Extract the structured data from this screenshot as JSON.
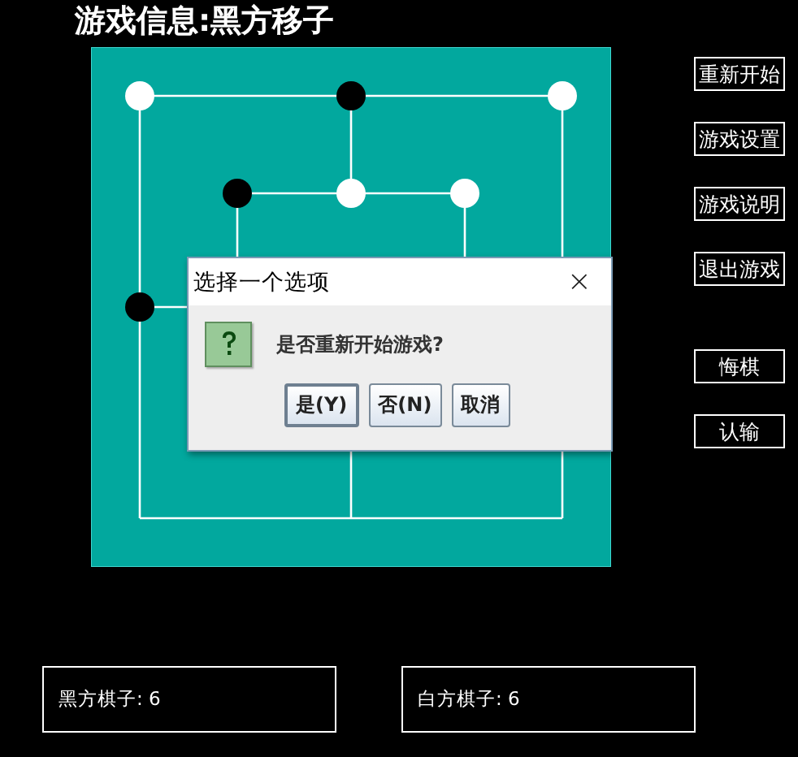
{
  "title": "游戏信息:黑方移子",
  "board": {
    "rows": [
      [
        {
          "kind": "piece",
          "color": "#ffffff"
        },
        {
          "kind": "empty"
        },
        {
          "kind": "piece",
          "color": "#000000"
        },
        {
          "kind": "empty"
        },
        {
          "kind": "piece",
          "color": "#ffffff"
        }
      ],
      [
        {
          "kind": "empty"
        },
        {
          "kind": "piece",
          "color": "#000000"
        },
        {
          "kind": "piece",
          "color": "#ffffff"
        },
        {
          "kind": "piece",
          "color": "#ffffff"
        },
        {
          "kind": "empty"
        }
      ],
      [
        {
          "kind": "piece",
          "color": "#000000"
        }
      ]
    ]
  },
  "menu_buttons": [
    "重新开始",
    "游戏设置",
    "游戏说明",
    "退出游戏",
    "悔棋",
    "认输"
  ],
  "counts": [
    {
      "label": "黑方棋子:",
      "value": "6"
    },
    {
      "label": "白方棋子:",
      "value": "6"
    }
  ],
  "dialog": {
    "title": "选择一个选项",
    "message": "是否重新开始游戏?",
    "close": "×",
    "buttons": [
      {
        "label": "是(Y)",
        "default": true
      },
      {
        "label": "否(N)",
        "default": false
      },
      {
        "label": "取消",
        "default": false
      }
    ]
  }
}
